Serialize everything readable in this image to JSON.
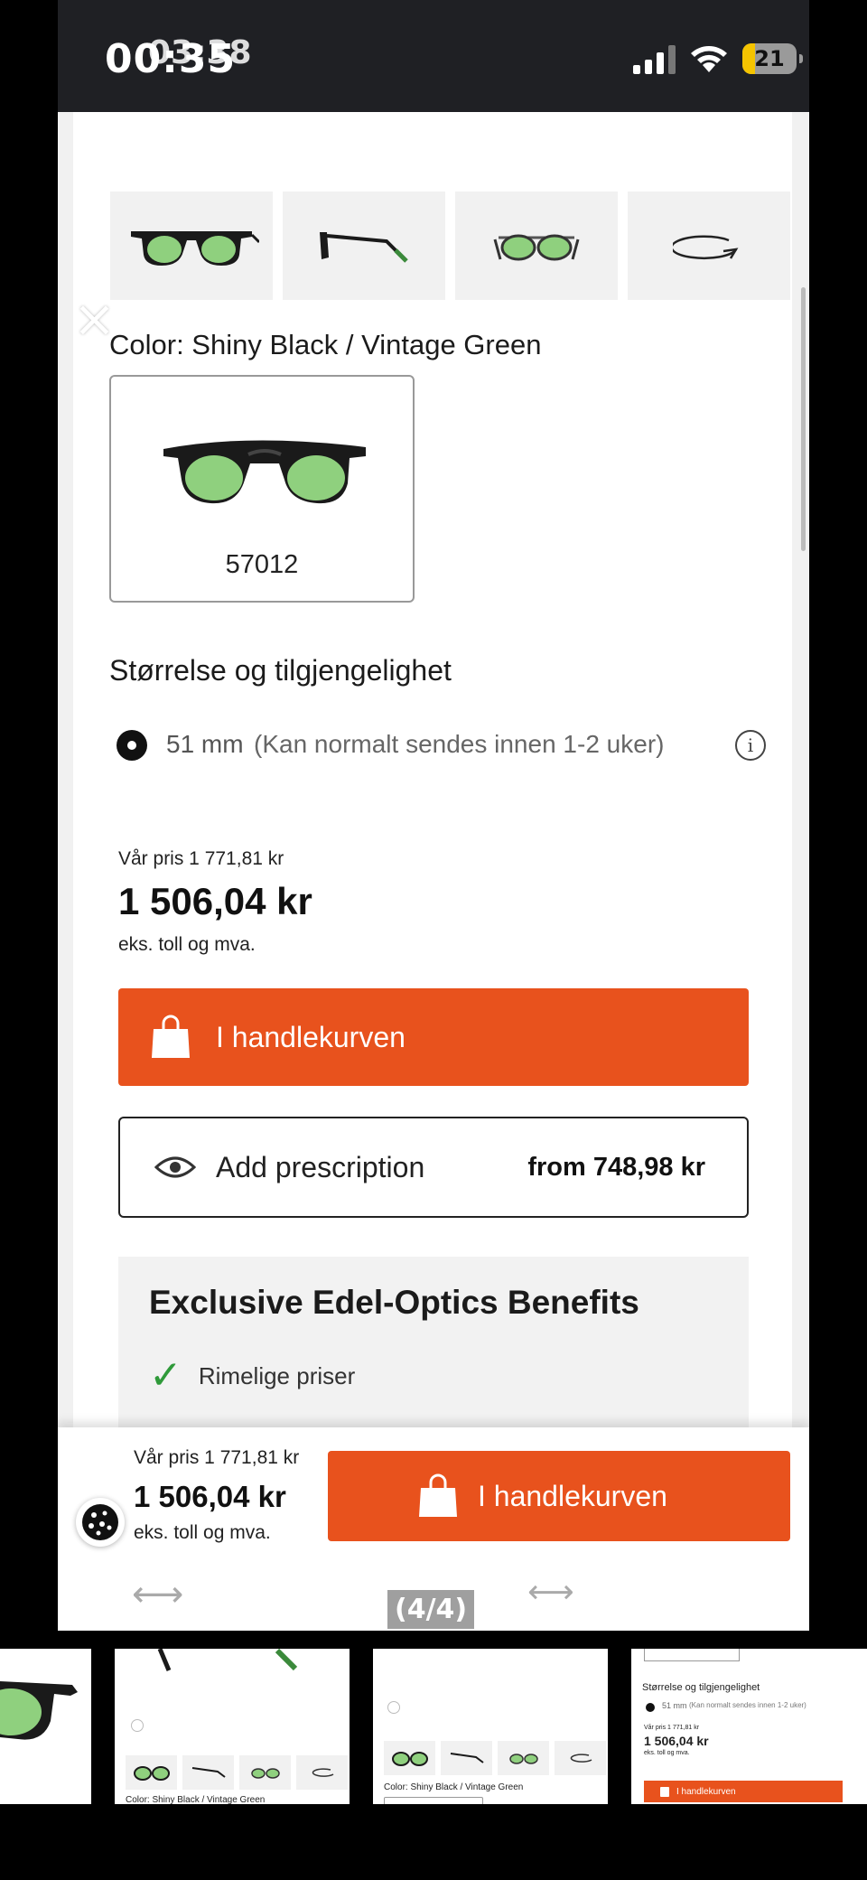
{
  "status_bar": {
    "time": "00:35",
    "time_overlay": "03:38",
    "battery_level": "21",
    "battery_overlay": "31"
  },
  "product": {
    "color_label": "Color: Shiny Black / Vintage Green",
    "variant_code": "57012",
    "size_title": "Størrelse og tilgjengelighet",
    "size_option": {
      "value": "51 mm",
      "availability": "(Kan normalt sendes innen 1-2 uker)",
      "selected": true
    }
  },
  "pricing": {
    "original_price": "Vår pris 1 771,81 kr",
    "price": "1 506,04 kr",
    "price_note": "eks. toll og mva."
  },
  "actions": {
    "cart_label": "I handlekurven",
    "prescription_label": "Add prescription",
    "prescription_from": "from 748,98 kr"
  },
  "benefits": {
    "title": "Exclusive Edel-Optics Benefits",
    "items": [
      "Rimelige priser"
    ]
  },
  "sticky_bar": {
    "original_price": "Vår pris 1 771,81 kr",
    "price": "1 506,04 kr",
    "price_note": "eks. toll og mva.",
    "cart_label": "I handlekurven"
  },
  "viewer": {
    "counter": "(4/4)"
  },
  "gallery": {
    "thumb2_caption": "Color: Shiny Black / Vintage Green",
    "thumb3_caption": "Color: Shiny Black / Vintage Green",
    "thumb4_size_title": "Størrelse og tilgjengelighet",
    "thumb4_size": "51 mm",
    "thumb4_availability": "(Kan normalt sendes innen 1-2 uker)",
    "thumb4_original": "Vår pris 1 771,81 kr",
    "thumb4_price": "1 506,04 kr",
    "thumb4_note": "eks. toll og mva.",
    "thumb4_cart": "I handlekurven"
  },
  "colors": {
    "accent": "#e8521d",
    "check": "#2f9a3a",
    "lens": "#8fd07e",
    "frame": "#1a1a1a"
  }
}
